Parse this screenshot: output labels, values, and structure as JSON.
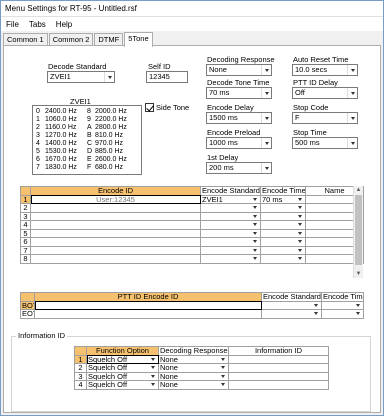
{
  "window": {
    "title": "Menu Settings for RT-95 - Untitled.rsf"
  },
  "menu": [
    "File",
    "Tabs",
    "Help"
  ],
  "tabs": [
    "Common 1",
    "Common 2",
    "DTMF",
    "5Tone"
  ],
  "decode_standard": {
    "label": "Decode Standard",
    "value": "ZVEI1"
  },
  "self_id": {
    "label": "Self ID",
    "value": "12345"
  },
  "zvei": {
    "title": "ZVEI1",
    "rows": [
      [
        "0",
        "2400.0 Hz",
        "8",
        "2000.0 Hz"
      ],
      [
        "1",
        "1060.0 Hz",
        "9",
        "2200.0 Hz"
      ],
      [
        "2",
        "1160.0 Hz",
        "A",
        "2800.0 Hz"
      ],
      [
        "3",
        "1270.0 Hz",
        "B",
        "810.0 Hz"
      ],
      [
        "4",
        "1400.0 Hz",
        "C",
        "970.0 Hz"
      ],
      [
        "5",
        "1530.0 Hz",
        "D",
        "885.0 Hz"
      ],
      [
        "6",
        "1670.0 Hz",
        "E",
        "2600.0 Hz"
      ],
      [
        "7",
        "1830.0 Hz",
        "F",
        "680.0 Hz"
      ]
    ]
  },
  "side_tone": {
    "label": "Side Tone",
    "checked": true
  },
  "fields_col1": [
    {
      "label": "Decoding Response",
      "value": "None"
    },
    {
      "label": "Decode Tone Time",
      "value": "70 ms"
    },
    {
      "label": "Encode Delay",
      "value": "1500 ms"
    },
    {
      "label": "Encode Preload",
      "value": "1000 ms"
    },
    {
      "label": "1st Delay",
      "value": "200 ms"
    }
  ],
  "fields_col2": [
    {
      "label": "Auto Reset Time",
      "value": "10.0 secs"
    },
    {
      "label": "PTT ID Delay",
      "value": "Off"
    },
    {
      "label": "Stop Code",
      "value": "F"
    },
    {
      "label": "Stop Time",
      "value": "500 ms"
    }
  ],
  "encode_table": {
    "headers": [
      "Encode ID",
      "Encode Standard",
      "Encode Time",
      "Name"
    ],
    "rows": [
      {
        "n": "1",
        "id": "User:12345",
        "std": "ZVEI1",
        "time": "70 ms",
        "name": ""
      },
      {
        "n": "2",
        "id": "",
        "std": "",
        "time": "",
        "name": ""
      },
      {
        "n": "3",
        "id": "",
        "std": "",
        "time": "",
        "name": ""
      },
      {
        "n": "4",
        "id": "",
        "std": "",
        "time": "",
        "name": ""
      },
      {
        "n": "5",
        "id": "",
        "std": "",
        "time": "",
        "name": ""
      },
      {
        "n": "6",
        "id": "",
        "std": "",
        "time": "",
        "name": ""
      },
      {
        "n": "7",
        "id": "",
        "std": "",
        "time": "",
        "name": ""
      },
      {
        "n": "8",
        "id": "",
        "std": "",
        "time": "",
        "name": ""
      }
    ]
  },
  "ptt_table": {
    "headers": [
      "PTT ID Encode ID",
      "Encode Standard",
      "Encode Time"
    ],
    "rows": [
      {
        "n": "BOT"
      },
      {
        "n": "EOT"
      }
    ]
  },
  "info": {
    "title": "Information ID",
    "headers": [
      "Function Option",
      "Decoding Response",
      "Information ID"
    ],
    "rows": [
      {
        "n": "1",
        "fn": "Squelch Off",
        "resp": "None",
        "info": ""
      },
      {
        "n": "2",
        "fn": "Squelch Off",
        "resp": "None",
        "info": ""
      },
      {
        "n": "3",
        "fn": "Squelch Off",
        "resp": "None",
        "info": ""
      },
      {
        "n": "4",
        "fn": "Squelch Off",
        "resp": "None",
        "info": ""
      }
    ]
  },
  "colors": {
    "header_highlight": "#f6c16e",
    "window_border": "#7a9ac9"
  }
}
